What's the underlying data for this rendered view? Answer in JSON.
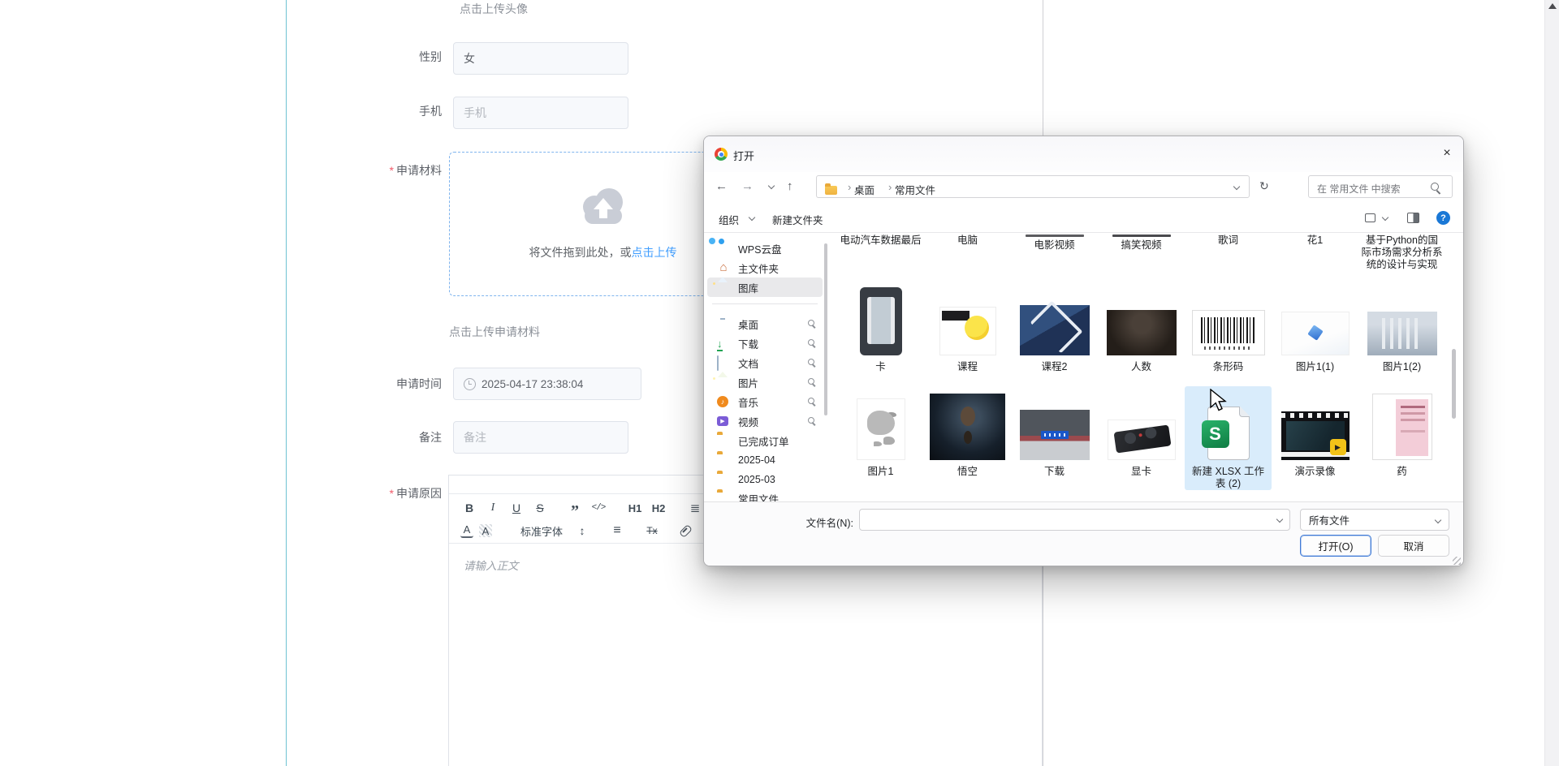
{
  "required_mark": "*",
  "form": {
    "avatar_hint": "点击上传头像",
    "gender": {
      "label": "性别",
      "value": "女"
    },
    "phone": {
      "label": "手机",
      "placeholder": "手机"
    },
    "materials": {
      "label": "申请材料",
      "drop_text": "将文件拖到此处，或",
      "upload_link": "点击上传",
      "hint": "点击上传申请材料"
    },
    "apply_time": {
      "label": "申请时间",
      "value": "2025-04-17 23:38:04"
    },
    "remark": {
      "label": "备注",
      "placeholder": "备注"
    },
    "reason": {
      "label": "申请原因",
      "placeholder": "请输入正文"
    },
    "editor": {
      "bold": "B",
      "italic": "I",
      "underline": "U",
      "strike": "S",
      "quote": "”",
      "code": "</>",
      "h1": "H1",
      "h2": "H2",
      "ordered_list": "≣",
      "font_color": "A",
      "highlight": "A",
      "font_name": "标准字体",
      "font_size": "↕",
      "align": "≡",
      "clear_format": "Tx"
    }
  },
  "dialog": {
    "title": "打开",
    "address": {
      "crumb_root": "桌面",
      "crumb_current": "常用文件",
      "search_placeholder": "在 常用文件 中搜索"
    },
    "toolbar": {
      "organize": "组织",
      "new_folder": "新建文件夹"
    },
    "sidebar": [
      {
        "label": "WPS云盘",
        "icon": "cloud"
      },
      {
        "label": "主文件夹",
        "icon": "home"
      },
      {
        "label": "图库",
        "icon": "gallery",
        "selected": true
      },
      {
        "label": "桌面",
        "icon": "desktop",
        "pinned": true
      },
      {
        "label": "下载",
        "icon": "download",
        "pinned": true
      },
      {
        "label": "文档",
        "icon": "document",
        "pinned": true
      },
      {
        "label": "图片",
        "icon": "pictures",
        "pinned": true
      },
      {
        "label": "音乐",
        "icon": "music",
        "pinned": true
      },
      {
        "label": "视频",
        "icon": "videos",
        "pinned": true
      },
      {
        "label": "已完成订单",
        "icon": "folder"
      },
      {
        "label": "2025-04",
        "icon": "folder"
      },
      {
        "label": "2025-03",
        "icon": "folder"
      },
      {
        "label": "常用文件",
        "icon": "folder"
      }
    ],
    "files_row1": [
      "电动汽车数据最后",
      "电脑",
      "电影视频",
      "搞笑视频",
      "歌词",
      "花1",
      "基于Python的国际市场需求分析系统的设计与实现"
    ],
    "files_row2": [
      "卡",
      "课程",
      "课程2",
      "人数",
      "条形码",
      "图片1(1)",
      "图片1(2)"
    ],
    "files_row3": [
      "图片1",
      "悟空",
      "下载",
      "显卡",
      "新建 XLSX 工作表 (2)",
      "演示录像",
      "药"
    ],
    "footer": {
      "filename_label": "文件名(N):",
      "filename_value": "",
      "filetype": "所有文件",
      "open_label": "打开(O)",
      "cancel_label": "取消"
    }
  },
  "colors": {
    "accent_blue": "#409eff",
    "required_red": "#f25b6b",
    "selection_blue": "#d9ecfb",
    "excel_green": "#1e9e5a",
    "help_blue": "#1a78d6",
    "teal_border": "#6ec3d2"
  }
}
